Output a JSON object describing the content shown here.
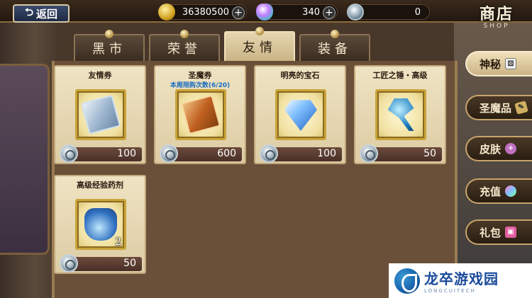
{
  "back_button": {
    "label": "返回"
  },
  "currencies": {
    "gold": {
      "value": "36380500",
      "icon": "gold-coin-icon"
    },
    "gems": {
      "value": "340",
      "icon": "rainbow-gem-icon"
    },
    "friendship_token": {
      "value": "0",
      "icon": "friendship-token-icon"
    }
  },
  "shop_title": {
    "zh": "商店",
    "en": "SHOP"
  },
  "tabs": [
    {
      "label": "黑市",
      "active": false
    },
    {
      "label": "荣誉",
      "active": false
    },
    {
      "label": "友情",
      "active": true
    },
    {
      "label": "装备",
      "active": false
    }
  ],
  "items": [
    {
      "name": "友情券",
      "limit": "",
      "price": "100",
      "count": "",
      "icon": "friendship-ticket-icon"
    },
    {
      "name": "圣魔券",
      "limit": "本周限购次数(6/20)",
      "price": "600",
      "count": "",
      "icon": "holy-demon-ticket-icon"
    },
    {
      "name": "明亮的宝石",
      "limit": "",
      "price": "100",
      "count": "",
      "icon": "bright-gem-icon"
    },
    {
      "name": "工匠之锤・高级",
      "limit": "",
      "price": "50",
      "count": "",
      "icon": "craftsman-hammer-icon"
    },
    {
      "name": "高级经验药剂",
      "limit": "",
      "price": "50",
      "count": "2",
      "icon": "exp-potion-icon"
    }
  ],
  "side_menu": [
    {
      "label": "神秘",
      "active": true,
      "icon": "dice-icon"
    },
    {
      "label": "圣魔品",
      "active": false,
      "icon": "tag-icon"
    },
    {
      "label": "皮肤",
      "active": false,
      "icon": "plus-circle-icon"
    },
    {
      "label": "充值",
      "active": false,
      "icon": "rainbow-icon"
    },
    {
      "label": "礼包",
      "active": false,
      "icon": "gift-icon"
    }
  ],
  "watermark": {
    "zh": "龙卒游戏园",
    "en": "LONGCUITECH"
  }
}
